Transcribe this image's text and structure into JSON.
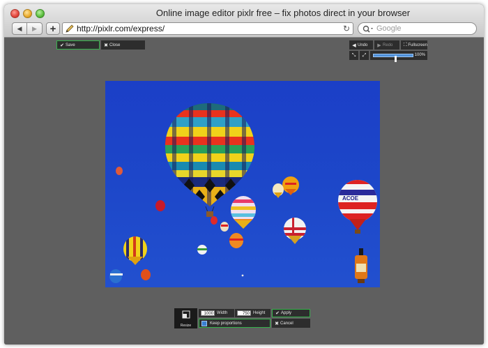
{
  "window": {
    "title": "Online image editor pixlr free – fix photos direct in your browser"
  },
  "toolbar": {
    "back_icon": "back-arrow-icon",
    "forward_icon": "forward-arrow-icon",
    "add_label": "+",
    "url": "http://pixlr.com/express/",
    "search_placeholder": "Google"
  },
  "editor": {
    "save_label": "Save",
    "close_label": "Close",
    "undo_label": "Undo",
    "redo_label": "Redo",
    "fullscreen_label": "Fullscreen",
    "zoom_percent": "100%",
    "zoom_level": 0.55,
    "accent_color": "#35b24a"
  },
  "resize_panel": {
    "icon_label": "Resize",
    "width_value": "1000",
    "width_label": "Width",
    "height_value": "750",
    "height_label": "Height",
    "keep_proportions_label": "Keep proportions",
    "keep_proportions_checked": true,
    "apply_label": "Apply",
    "cancel_label": "Cancel"
  }
}
